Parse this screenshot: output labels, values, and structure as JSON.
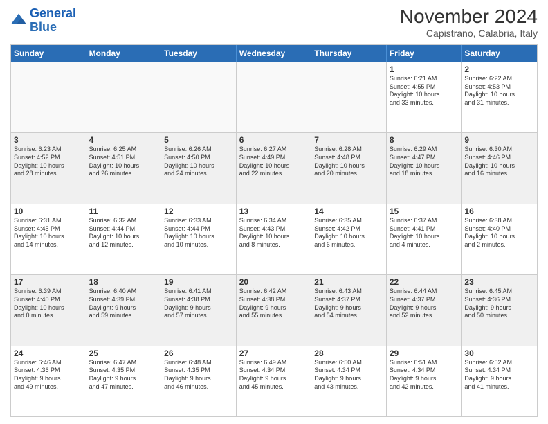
{
  "logo": {
    "line1": "General",
    "line2": "Blue"
  },
  "title": "November 2024",
  "location": "Capistrano, Calabria, Italy",
  "header_days": [
    "Sunday",
    "Monday",
    "Tuesday",
    "Wednesday",
    "Thursday",
    "Friday",
    "Saturday"
  ],
  "weeks": [
    [
      {
        "day": "",
        "info": ""
      },
      {
        "day": "",
        "info": ""
      },
      {
        "day": "",
        "info": ""
      },
      {
        "day": "",
        "info": ""
      },
      {
        "day": "",
        "info": ""
      },
      {
        "day": "1",
        "info": "Sunrise: 6:21 AM\nSunset: 4:55 PM\nDaylight: 10 hours\nand 33 minutes."
      },
      {
        "day": "2",
        "info": "Sunrise: 6:22 AM\nSunset: 4:53 PM\nDaylight: 10 hours\nand 31 minutes."
      }
    ],
    [
      {
        "day": "3",
        "info": "Sunrise: 6:23 AM\nSunset: 4:52 PM\nDaylight: 10 hours\nand 28 minutes."
      },
      {
        "day": "4",
        "info": "Sunrise: 6:25 AM\nSunset: 4:51 PM\nDaylight: 10 hours\nand 26 minutes."
      },
      {
        "day": "5",
        "info": "Sunrise: 6:26 AM\nSunset: 4:50 PM\nDaylight: 10 hours\nand 24 minutes."
      },
      {
        "day": "6",
        "info": "Sunrise: 6:27 AM\nSunset: 4:49 PM\nDaylight: 10 hours\nand 22 minutes."
      },
      {
        "day": "7",
        "info": "Sunrise: 6:28 AM\nSunset: 4:48 PM\nDaylight: 10 hours\nand 20 minutes."
      },
      {
        "day": "8",
        "info": "Sunrise: 6:29 AM\nSunset: 4:47 PM\nDaylight: 10 hours\nand 18 minutes."
      },
      {
        "day": "9",
        "info": "Sunrise: 6:30 AM\nSunset: 4:46 PM\nDaylight: 10 hours\nand 16 minutes."
      }
    ],
    [
      {
        "day": "10",
        "info": "Sunrise: 6:31 AM\nSunset: 4:45 PM\nDaylight: 10 hours\nand 14 minutes."
      },
      {
        "day": "11",
        "info": "Sunrise: 6:32 AM\nSunset: 4:44 PM\nDaylight: 10 hours\nand 12 minutes."
      },
      {
        "day": "12",
        "info": "Sunrise: 6:33 AM\nSunset: 4:44 PM\nDaylight: 10 hours\nand 10 minutes."
      },
      {
        "day": "13",
        "info": "Sunrise: 6:34 AM\nSunset: 4:43 PM\nDaylight: 10 hours\nand 8 minutes."
      },
      {
        "day": "14",
        "info": "Sunrise: 6:35 AM\nSunset: 4:42 PM\nDaylight: 10 hours\nand 6 minutes."
      },
      {
        "day": "15",
        "info": "Sunrise: 6:37 AM\nSunset: 4:41 PM\nDaylight: 10 hours\nand 4 minutes."
      },
      {
        "day": "16",
        "info": "Sunrise: 6:38 AM\nSunset: 4:40 PM\nDaylight: 10 hours\nand 2 minutes."
      }
    ],
    [
      {
        "day": "17",
        "info": "Sunrise: 6:39 AM\nSunset: 4:40 PM\nDaylight: 10 hours\nand 0 minutes."
      },
      {
        "day": "18",
        "info": "Sunrise: 6:40 AM\nSunset: 4:39 PM\nDaylight: 9 hours\nand 59 minutes."
      },
      {
        "day": "19",
        "info": "Sunrise: 6:41 AM\nSunset: 4:38 PM\nDaylight: 9 hours\nand 57 minutes."
      },
      {
        "day": "20",
        "info": "Sunrise: 6:42 AM\nSunset: 4:38 PM\nDaylight: 9 hours\nand 55 minutes."
      },
      {
        "day": "21",
        "info": "Sunrise: 6:43 AM\nSunset: 4:37 PM\nDaylight: 9 hours\nand 54 minutes."
      },
      {
        "day": "22",
        "info": "Sunrise: 6:44 AM\nSunset: 4:37 PM\nDaylight: 9 hours\nand 52 minutes."
      },
      {
        "day": "23",
        "info": "Sunrise: 6:45 AM\nSunset: 4:36 PM\nDaylight: 9 hours\nand 50 minutes."
      }
    ],
    [
      {
        "day": "24",
        "info": "Sunrise: 6:46 AM\nSunset: 4:36 PM\nDaylight: 9 hours\nand 49 minutes."
      },
      {
        "day": "25",
        "info": "Sunrise: 6:47 AM\nSunset: 4:35 PM\nDaylight: 9 hours\nand 47 minutes."
      },
      {
        "day": "26",
        "info": "Sunrise: 6:48 AM\nSunset: 4:35 PM\nDaylight: 9 hours\nand 46 minutes."
      },
      {
        "day": "27",
        "info": "Sunrise: 6:49 AM\nSunset: 4:34 PM\nDaylight: 9 hours\nand 45 minutes."
      },
      {
        "day": "28",
        "info": "Sunrise: 6:50 AM\nSunset: 4:34 PM\nDaylight: 9 hours\nand 43 minutes."
      },
      {
        "day": "29",
        "info": "Sunrise: 6:51 AM\nSunset: 4:34 PM\nDaylight: 9 hours\nand 42 minutes."
      },
      {
        "day": "30",
        "info": "Sunrise: 6:52 AM\nSunset: 4:34 PM\nDaylight: 9 hours\nand 41 minutes."
      }
    ]
  ]
}
